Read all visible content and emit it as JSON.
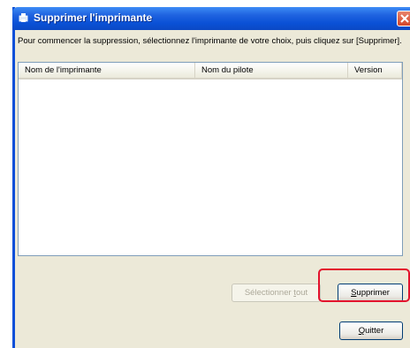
{
  "dialog": {
    "title": "Supprimer l'imprimante",
    "instructions": "Pour commencer la suppression, sélectionnez l'imprimante de votre choix, puis cliquez sur [Supprimer].",
    "columns": [
      "Nom de l'imprimante",
      "Nom du pilote",
      "Version"
    ],
    "rows": [],
    "buttons": {
      "select_all_prefix": "Sélectionner ",
      "select_all_mnemonic": "t",
      "select_all_suffix": "out",
      "delete_mnemonic": "S",
      "delete_suffix": "upprimer",
      "quit_mnemonic": "Q",
      "quit_suffix": "uitter"
    },
    "highlight_color": "#e3122d",
    "title_bar_color": "#0a51d6"
  }
}
